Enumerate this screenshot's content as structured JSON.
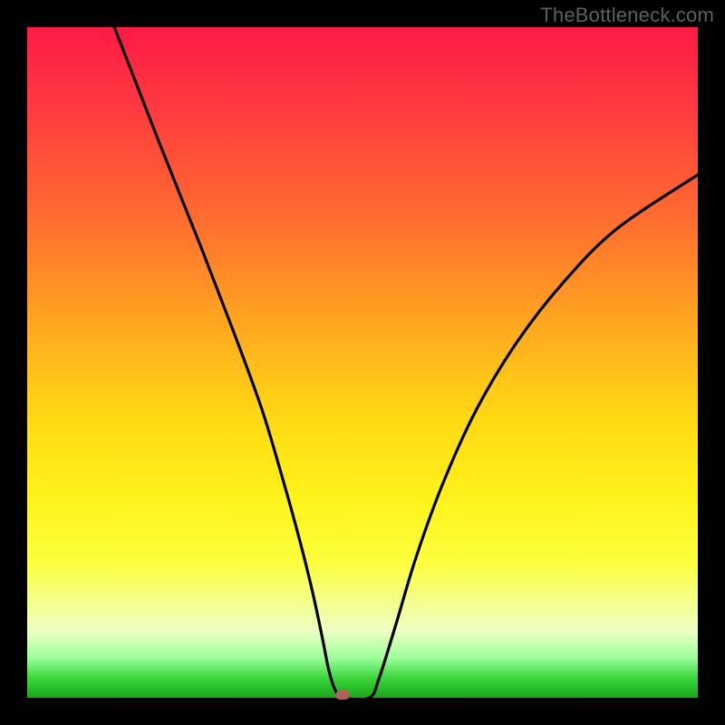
{
  "watermark": "TheBottleneck.com",
  "chart_data": {
    "type": "line",
    "title": "",
    "xlabel": "",
    "ylabel": "",
    "xlim": [
      0,
      100
    ],
    "ylim": [
      0,
      100
    ],
    "grid": false,
    "legend": false,
    "series": [
      {
        "name": "curve",
        "x": [
          13,
          20,
          26,
          31,
          35,
          38,
          40.5,
          42.5,
          44,
          45,
          46,
          47,
          51,
          52.5,
          55,
          58,
          62,
          67,
          73,
          80,
          88,
          100
        ],
        "y": [
          100,
          82,
          67,
          54,
          43,
          33,
          24,
          16,
          9,
          4,
          1,
          0,
          0,
          3,
          11,
          21,
          32,
          43,
          53,
          62,
          70,
          78
        ]
      }
    ],
    "marker": {
      "x": 47,
      "y": 0,
      "color": "#b1605d"
    },
    "background_gradient": {
      "top": "#ff1a47",
      "mid": "#fff21a",
      "bottom": "#19a519"
    }
  }
}
